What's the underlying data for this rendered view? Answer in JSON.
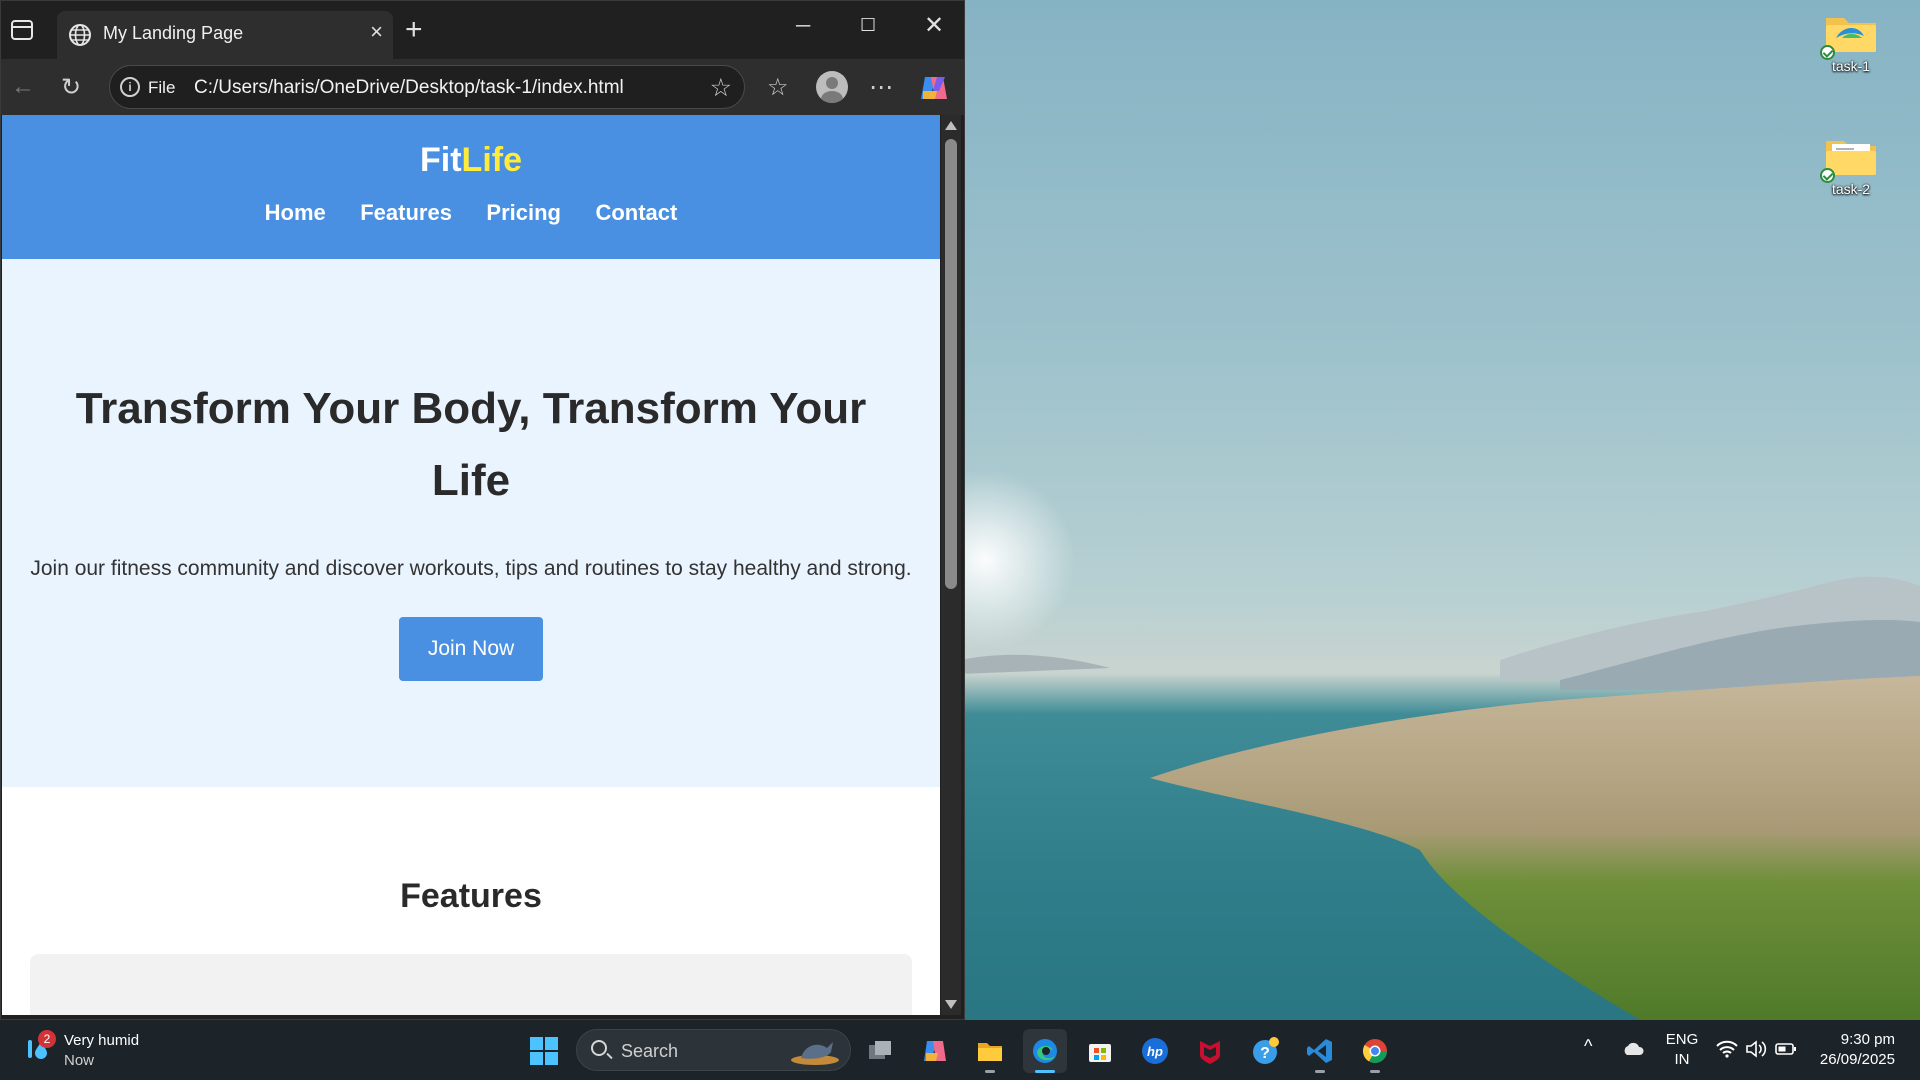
{
  "desktop": {
    "icons": [
      {
        "label": "task-1"
      },
      {
        "label": "task-2"
      }
    ]
  },
  "browser": {
    "tab_title": "My Landing Page",
    "address_scheme": "File",
    "address_url": "C:/Users/haris/OneDrive/Desktop/task-1/index.html"
  },
  "page": {
    "logo_main": "Fit",
    "logo_accent": "Life",
    "nav": [
      "Home",
      "Features",
      "Pricing",
      "Contact"
    ],
    "hero_title": "Transform Your Body, Transform Your Life",
    "hero_text": "Join our fitness community and discover workouts, tips and routines to stay healthy and strong.",
    "cta": "Join Now",
    "features_heading": "Features"
  },
  "colors": {
    "header_blue": "#4a90e2",
    "logo_accent": "#ffeb3b",
    "hero_bg": "#eaf4ff",
    "taskbar": "#1c2329"
  },
  "taskbar": {
    "weather_badge": "2",
    "weather_line1": "Very humid",
    "weather_line2": "Now",
    "search_placeholder": "Search",
    "apps": [
      "task-view-icon",
      "copilot-icon",
      "file-explorer-icon",
      "edge-icon",
      "store-icon",
      "hp-icon",
      "mcafee-icon",
      "help-icon",
      "vscode-icon",
      "chrome-icon"
    ],
    "lang_line1": "ENG",
    "lang_line2": "IN",
    "time": "9:30 pm",
    "date": "26/09/2025"
  }
}
